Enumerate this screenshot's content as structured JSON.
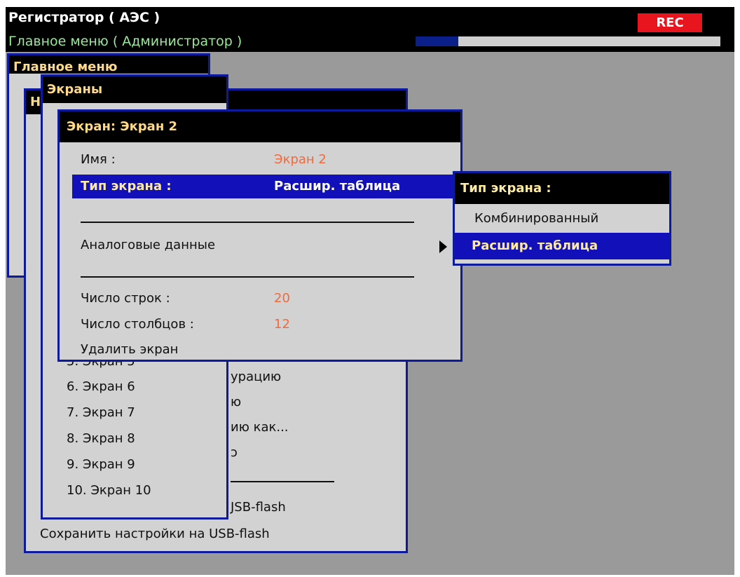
{
  "header": {
    "title": "Регистратор ( АЭС )",
    "subtitle": "Главное меню ( Администратор )",
    "rec_label": "REC",
    "progress_fraction": 0.14
  },
  "main_menu": {
    "title": "Главное меню",
    "items": [
      "урацию",
      "ю",
      "ию как...",
      "",
      "JSB-flash",
      "Сохранить настройки на USB-flash"
    ]
  },
  "settings_window": {
    "title": "Н"
  },
  "screens_window": {
    "title": "Экраны",
    "items": [
      "5. Экран 5",
      "6. Экран 6",
      "7. Экран 7",
      "8. Экран 8",
      "9. Экран 9",
      "10. Экран 10"
    ]
  },
  "screen_dialog": {
    "title": "Экран: Экран 2",
    "name_label": "Имя :",
    "name_value": "Экран 2",
    "type_label": "Тип экрана :",
    "type_value": "Расшир. таблица",
    "analog_label": "Аналоговые данные",
    "rows_label": "Число строк :",
    "rows_value": "20",
    "cols_label": "Число столбцов :",
    "cols_value": "12",
    "delete_label": "Удалить экран"
  },
  "type_popup": {
    "title": "Тип экрана :",
    "options": [
      "Комбинированный",
      "Расшир. таблица"
    ],
    "selected_index": 1
  },
  "colors": {
    "background": "#9a9a9a",
    "header": "#000000",
    "window_border": "#0d1a9c",
    "selection": "#1210b8",
    "value_text": "#ef6a3e",
    "title_text": "#ffd98a",
    "rec": "#e8141e"
  },
  "icons": {
    "submenu_arrow": "triangle-right-icon"
  }
}
